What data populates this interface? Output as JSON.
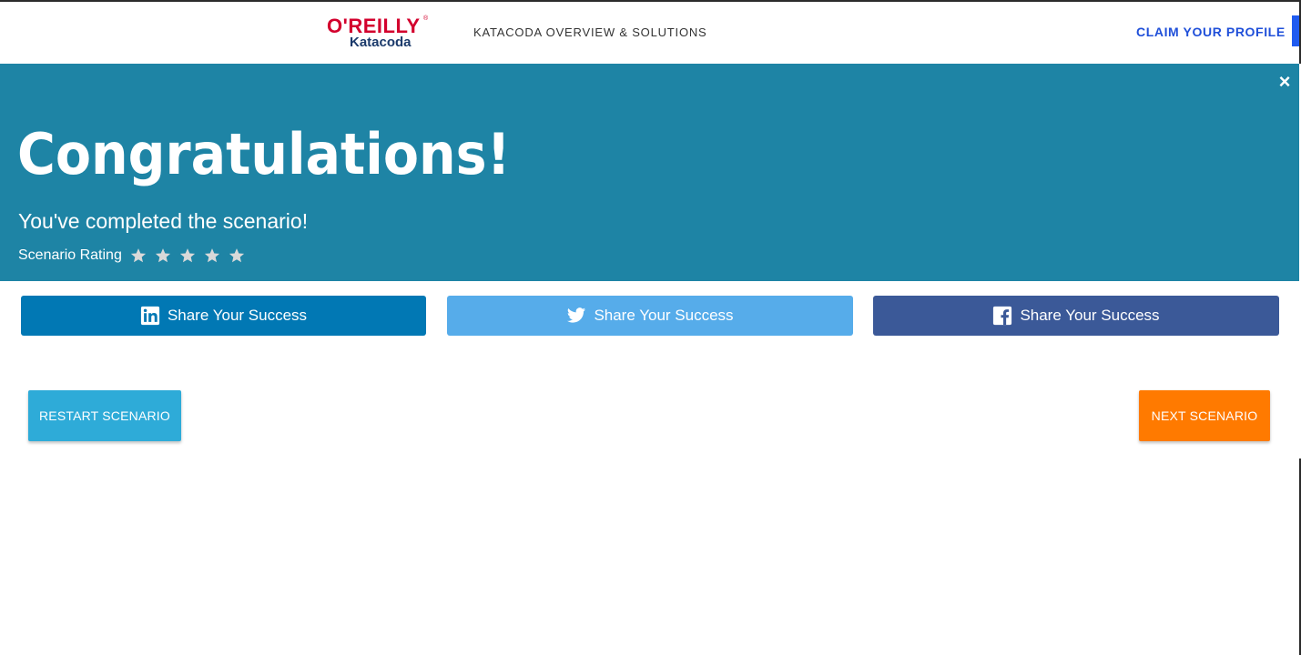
{
  "header": {
    "logo_top": "O'REILLY",
    "logo_reg": "®",
    "logo_bottom": "Katacoda",
    "nav_link": "KATACODA OVERVIEW & SOLUTIONS",
    "claim_link": "CLAIM YOUR PROFILE"
  },
  "banner": {
    "close_icon": "×",
    "title": "Congratulations!",
    "subtitle": "You've completed the scenario!",
    "rating_label": "Scenario Rating",
    "rating_stars_total": 5,
    "rating_stars_filled": 0,
    "background_color": "#1e84a5"
  },
  "share": {
    "linkedin": {
      "label": "Share Your Success",
      "icon": "linkedin-icon",
      "color": "#0178b4"
    },
    "twitter": {
      "label": "Share Your Success",
      "icon": "twitter-icon",
      "color": "#56acea"
    },
    "facebook": {
      "label": "Share Your Success",
      "icon": "facebook-icon",
      "color": "#3b5998"
    }
  },
  "actions": {
    "restart_label": "RESTART SCENARIO",
    "next_label": "NEXT SCENARIO",
    "restart_color": "#2eabd8",
    "next_color": "#ff7a00"
  }
}
